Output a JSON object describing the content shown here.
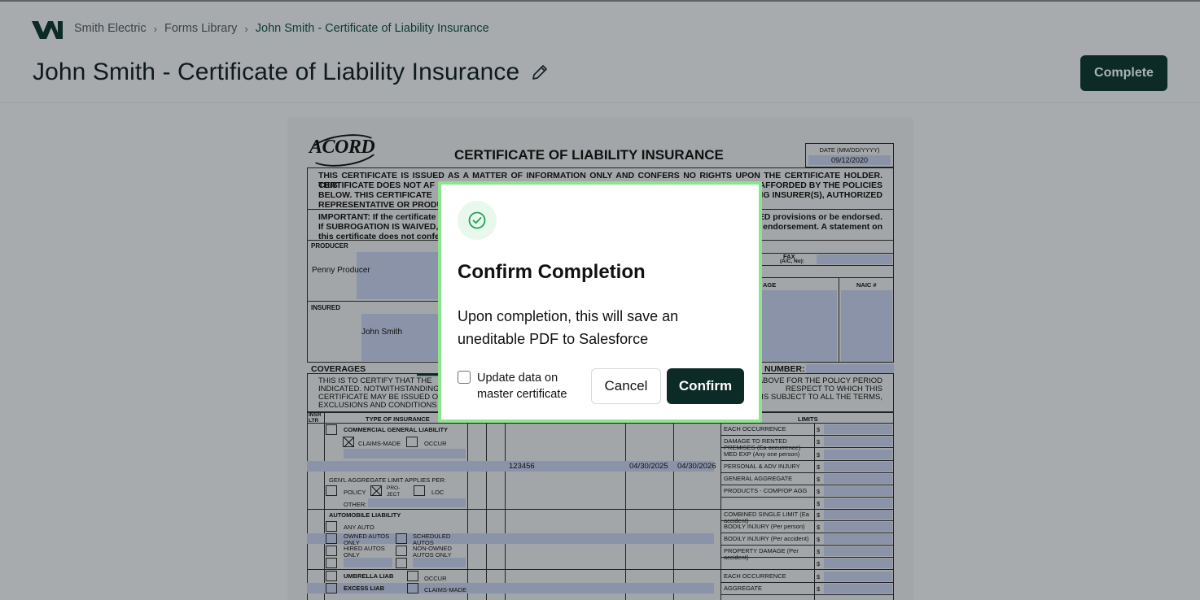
{
  "header": {
    "breadcrumbs": [
      "Smith Electric",
      "Forms Library",
      "John Smith - Certificate of Liability Insurance"
    ],
    "title": "John Smith - Certificate of Liability Insurance",
    "complete_label": "Complete"
  },
  "document": {
    "brand": "ACORD",
    "title": "CERTIFICATE OF LIABILITY INSURANCE",
    "date_label": "DATE (MM/DD/YYYY)",
    "date_value": "09/12/2020",
    "disclaimer_line1": "THIS CERTIFICATE IS ISSUED AS A MATTER OF INFORMATION ONLY AND CONFERS NO RIGHTS UPON THE CERTIFICATE HOLDER. THIS",
    "disclaimer_line2a": "CERTIFICATE DOES NOT AF",
    "disclaimer_line2b": "AFFORDED BY THE POLICIES",
    "disclaimer_line3a": "BELOW.  THIS CERTIFICATE",
    "disclaimer_line3b": "ING INSURER(S), AUTHORIZED",
    "disclaimer_line4a": "REPRESENTATIVE OR PRODU",
    "important_line1a": "IMPORTANT:  If the certificate",
    "important_line1b": "ED provisions or be endorsed.",
    "important_line2a": "If SUBROGATION IS WAIVED,",
    "important_line2b": "endorsement.  A statement on",
    "important_line3a": "this certificate does not confer",
    "producer_label": "PRODUCER",
    "producer_value": "Penny Producer",
    "fax_label": "FAX",
    "fax_sub": "(A/C, No):",
    "age_label": "AGE",
    "naic_label": "NAIC #",
    "insured_label": "INSURED",
    "insured_value": "John Smith",
    "coverages_label": "COVERAGES",
    "number_label": "NUMBER:",
    "cert_line1a": "THIS IS TO CERTIFY THAT THE",
    "cert_line1b": "ABOVE FOR THE POLICY PERIOD",
    "cert_line2a": "INDICATED.  NOTWITHSTANDING",
    "cert_line2b": "RESPECT TO WHICH THIS",
    "cert_line3a": "CERTIFICATE MAY BE ISSUED O",
    "cert_line3b": "IS SUBJECT TO ALL THE TERMS,",
    "cert_line4a": "EXCLUSIONS AND CONDITIONS O",
    "insr_ltr": "INSR LTR",
    "type_of_insurance": "TYPE OF INSURANCE",
    "limits": "LIMITS",
    "cgl": "COMMERCIAL GENERAL LIABILITY",
    "claims_made": "CLAIMS-MADE",
    "occur": "OCCUR",
    "policy_number": "123456",
    "eff_date": "04/30/2025",
    "exp_date": "04/30/2026",
    "aggregate_applies": "GEN'L AGGREGATE LIMIT APPLIES PER:",
    "policy": "POLICY",
    "project": "PRO-JECT",
    "loc": "LOC",
    "other": "OTHER:",
    "auto_liability": "AUTOMOBILE LIABILITY",
    "any_auto": "ANY AUTO",
    "owned_autos": "OWNED AUTOS ONLY",
    "scheduled_autos": "SCHEDULED AUTOS",
    "hired_autos": "HIRED AUTOS ONLY",
    "nonowned_autos": "NON-OWNED AUTOS ONLY",
    "umbrella": "UMBRELLA LIAB",
    "excess": "EXCESS LIAB",
    "limit_rows": [
      "EACH OCCURRENCE",
      "DAMAGE TO RENTED PREMISES (Ea occurrence)",
      "MED EXP (Any one person)",
      "PERSONAL & ADV INJURY",
      "GENERAL AGGREGATE",
      "PRODUCTS - COMP/OP AGG",
      "",
      "COMBINED SINGLE LIMIT (Ea accident)",
      "BODILY INJURY (Per person)",
      "BODILY INJURY (Per accident)",
      "PROPERTY DAMAGE (Per accident)",
      "",
      "EACH OCCURRENCE",
      "AGGREGATE"
    ],
    "dollar": "$"
  },
  "modal": {
    "title": "Confirm Completion",
    "body": "Upon completion, this will save an uneditable PDF to Salesforce",
    "checkbox_label": "Update data on master certificate",
    "cancel_label": "Cancel",
    "confirm_label": "Confirm"
  }
}
